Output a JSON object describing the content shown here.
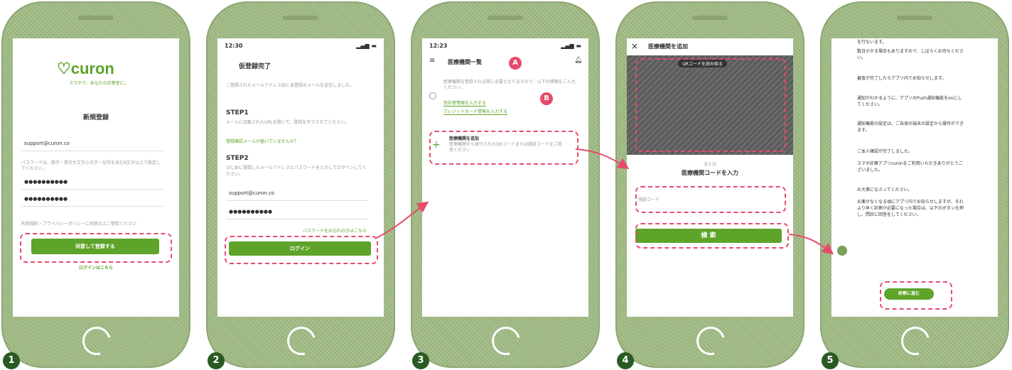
{
  "steps": [
    "1",
    "2",
    "3",
    "4",
    "5"
  ],
  "s1": {
    "logo": "curon",
    "tagline": "スマホで、あなたの診察室に。",
    "title": "新規登録",
    "email": "support@curon.co",
    "note": "パスワードは、数字・英字大文字小文字・記号を含む8文字以上で設定してください。",
    "pw1": "●●●●●●●●●●",
    "pw2": "●●●●●●●●●●",
    "terms": "利用規約・プライバシーポリシーに同意の上ご登録ください",
    "button": "同意して登録する",
    "login_link": "ログインはこちら"
  },
  "s2": {
    "time": "12:30",
    "title": "仮登録完了",
    "body": "ご登録されたメールアドレス宛に本登録のメールを送信しました。",
    "step1": "STEP1",
    "step1_text": "メールに記載されたURLを開いて、登録を完了させてください。",
    "step1_link": "登録確認メールが届いていませんか？",
    "step2": "STEP2",
    "step2_text": "はじめに登録したメールアドレスとパスワードを入力してログインしてください。",
    "email": "support@curon.co",
    "pw": "●●●●●●●●●●",
    "forgot": "パスワードをお忘れの方はこちら",
    "button": "ログイン"
  },
  "s3": {
    "time": "12:23",
    "title": "医療機関一覧",
    "text": "医療機関を登録される際に必要となりますので、以下の情報をご入力ください。",
    "link_a": "受診者情報を入力する",
    "link_b": "クレジットカード情報を入力する",
    "label_a": "A",
    "label_b": "B",
    "add_title": "医療機関を追加",
    "add_text": "医療機関から発行されたQRコードまたは施設コードをご用意ください",
    "plus": "+"
  },
  "s4": {
    "close": "×",
    "title": "医療機関を追加",
    "qr_label": "QRコードを読み取る",
    "or": "または",
    "code_label": "医療機関コードを入力",
    "placeholder": "施設コード",
    "button": "検 索"
  },
  "s5": {
    "msgs": [
      "を行ないます。",
      "数日かかる場合もありますので、しばらくお待ちください。",
      "審査が完了したらアプリ内でお知らせします。",
      "通知がわかるように、アプリのPush通知機能をonにしてください。",
      "通知機能の設定は、ご自身の端末の設定から操作ができます。",
      "ご本人確認が完了しました。",
      "スマホ診療アプリcuronをご利用いただきありがとうございました。",
      "お大事になさってください。",
      "お薬がなくなる頃にアプリ内でお知らせしますが、それより早く診察が必要になった場合は、以下のボタンを押し、問診に回答をしてください。"
    ],
    "button": "診察に進む"
  },
  "colors": {
    "accent": "#5ea32a",
    "highlight": "#e64b6c",
    "frame": "#a9c18f",
    "badge": "#2a5a23"
  }
}
